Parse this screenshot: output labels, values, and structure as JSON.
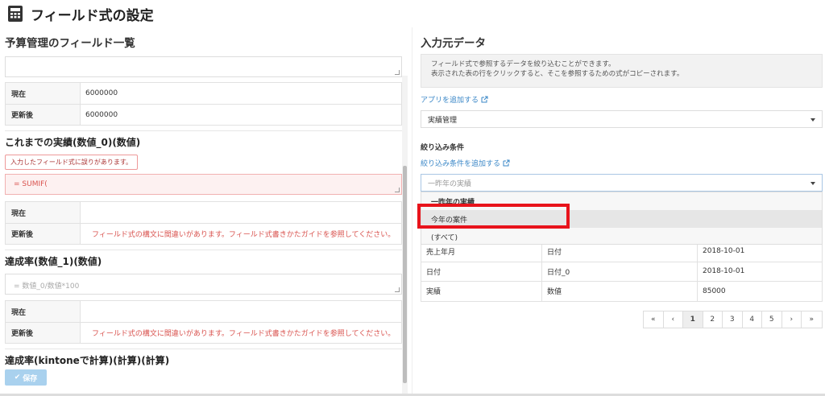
{
  "header": {
    "title": "フィールド式の設定",
    "icon": "calculator-icon"
  },
  "left": {
    "title": "予算管理のフィールド一覧",
    "first_field": {
      "textarea_value": "",
      "current_label": "現在",
      "current_value": "6000000",
      "updated_label": "更新後",
      "updated_value": "6000000"
    },
    "field2": {
      "title": "これまでの実績(数値_0)(数値)",
      "error_badge": "入力したフィールド式に誤りがあります。",
      "formula": "= SUMIF(",
      "current_label": "現在",
      "current_value": "",
      "updated_label": "更新後",
      "updated_value": "フィールド式の構文に間違いがあります。フィールド式書きかたガイドを参照してください。"
    },
    "field3": {
      "title": "達成率(数値_1)(数値)",
      "formula": "= 数値_0/数値*100",
      "current_label": "現在",
      "current_value": "",
      "updated_label": "更新後",
      "updated_value": "フィールド式の構文に間違いがあります。フィールド式書きかたガイドを参照してください。"
    },
    "field4": {
      "title": "達成率(kintoneで計算)(計算)(計算)"
    },
    "save_label": "保存"
  },
  "right": {
    "title": "入力元データ",
    "info_line1": "フィールド式で参照するデータを絞り込むことができます。",
    "info_line2": "表示された表の行をクリックすると、そこを参照するための式がコピーされます。",
    "add_app_link": "アプリを追加する",
    "app_select": "実績管理",
    "filter_label": "絞り込み条件",
    "add_filter_link": "絞り込み条件を追加する",
    "filter_select": "一昨年の実績",
    "dropdown_options": [
      "一昨年の実績",
      "今年の案件",
      "(すべて)"
    ],
    "table": [
      [
        "売上年月",
        "日付",
        "2018-10-01"
      ],
      [
        "日付",
        "日付_0",
        "2018-10-01"
      ],
      [
        "実績",
        "数値",
        "85000"
      ]
    ],
    "pager": [
      "«",
      "‹",
      "1",
      "2",
      "3",
      "4",
      "5",
      "›",
      "»"
    ],
    "pager_active": "1"
  },
  "colors": {
    "link": "#3a87c7",
    "error": "#d9534f",
    "highlight_box": "#e8131b",
    "save_button": "#a9d1ee"
  }
}
